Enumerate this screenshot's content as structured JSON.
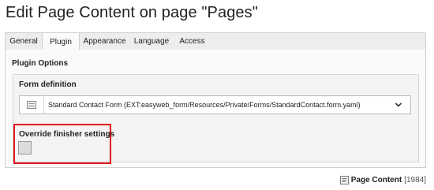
{
  "page": {
    "title": "Edit Page Content on page \"Pages\""
  },
  "tabs": [
    {
      "label": "General",
      "active": false
    },
    {
      "label": "Plugin",
      "active": true
    },
    {
      "label": "Appearance",
      "active": false
    },
    {
      "label": "Language",
      "active": false
    },
    {
      "label": "Access",
      "active": false
    }
  ],
  "plugin": {
    "section_title": "Plugin Options",
    "form_definition": {
      "label": "Form definition",
      "value": "Standard Contact Form (EXT:easyweb_form/Resources/Private/Forms/StandardContact.form.yaml)"
    },
    "override": {
      "label": "Override finisher settings",
      "checked": false
    }
  },
  "footer": {
    "record_type": "Page Content",
    "record_uid": "[1984]"
  },
  "colors": {
    "highlight_border": "#e01818",
    "tab_bar": "#ededed",
    "panel_bg": "#fafafa"
  },
  "icons": {
    "select_icon": "form-icon",
    "chevron": "chevron-down-icon",
    "record": "content-record-icon"
  }
}
